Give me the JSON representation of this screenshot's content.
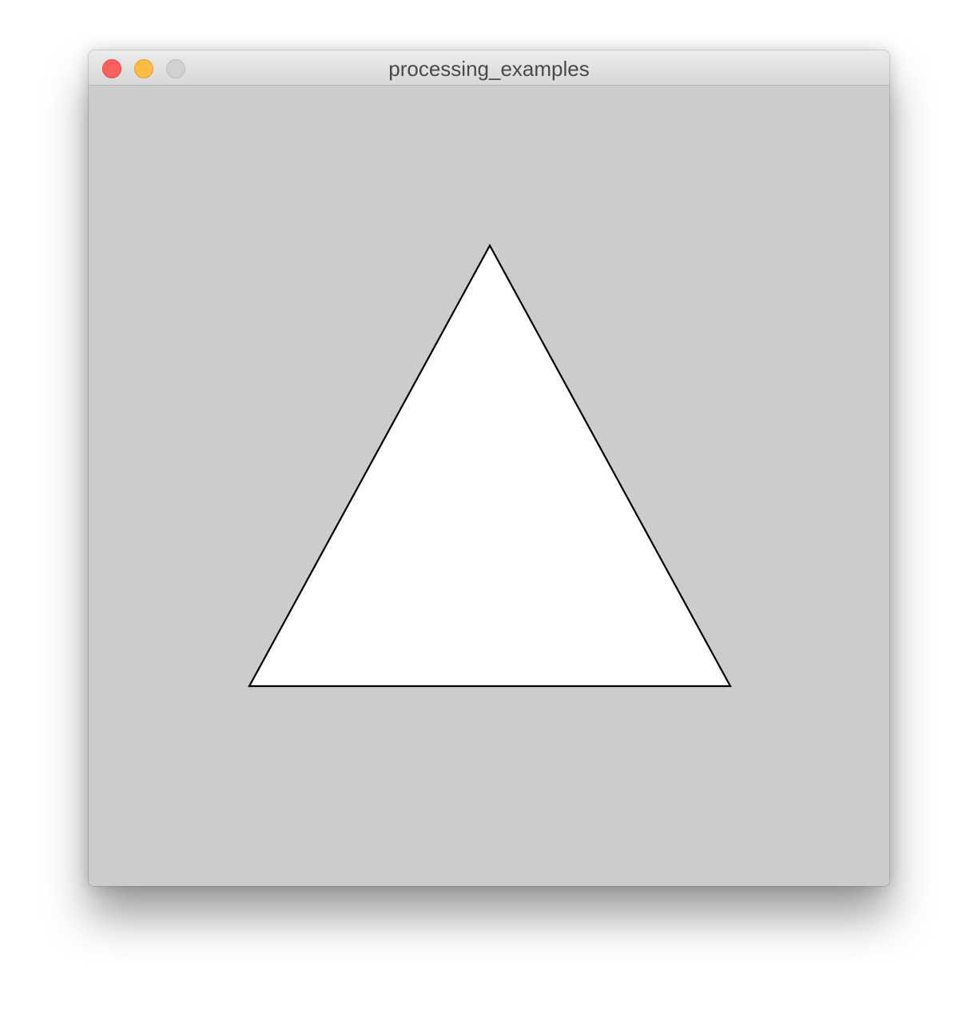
{
  "window": {
    "title": "processing_examples",
    "controls": {
      "close_color": "#fc615d",
      "minimize_color": "#fdbc40",
      "zoom_color": "#d1d1d1"
    }
  },
  "sketch": {
    "background_color": "#cccccc",
    "shape": "triangle",
    "fill_color": "#ffffff",
    "stroke_color": "#000000"
  }
}
